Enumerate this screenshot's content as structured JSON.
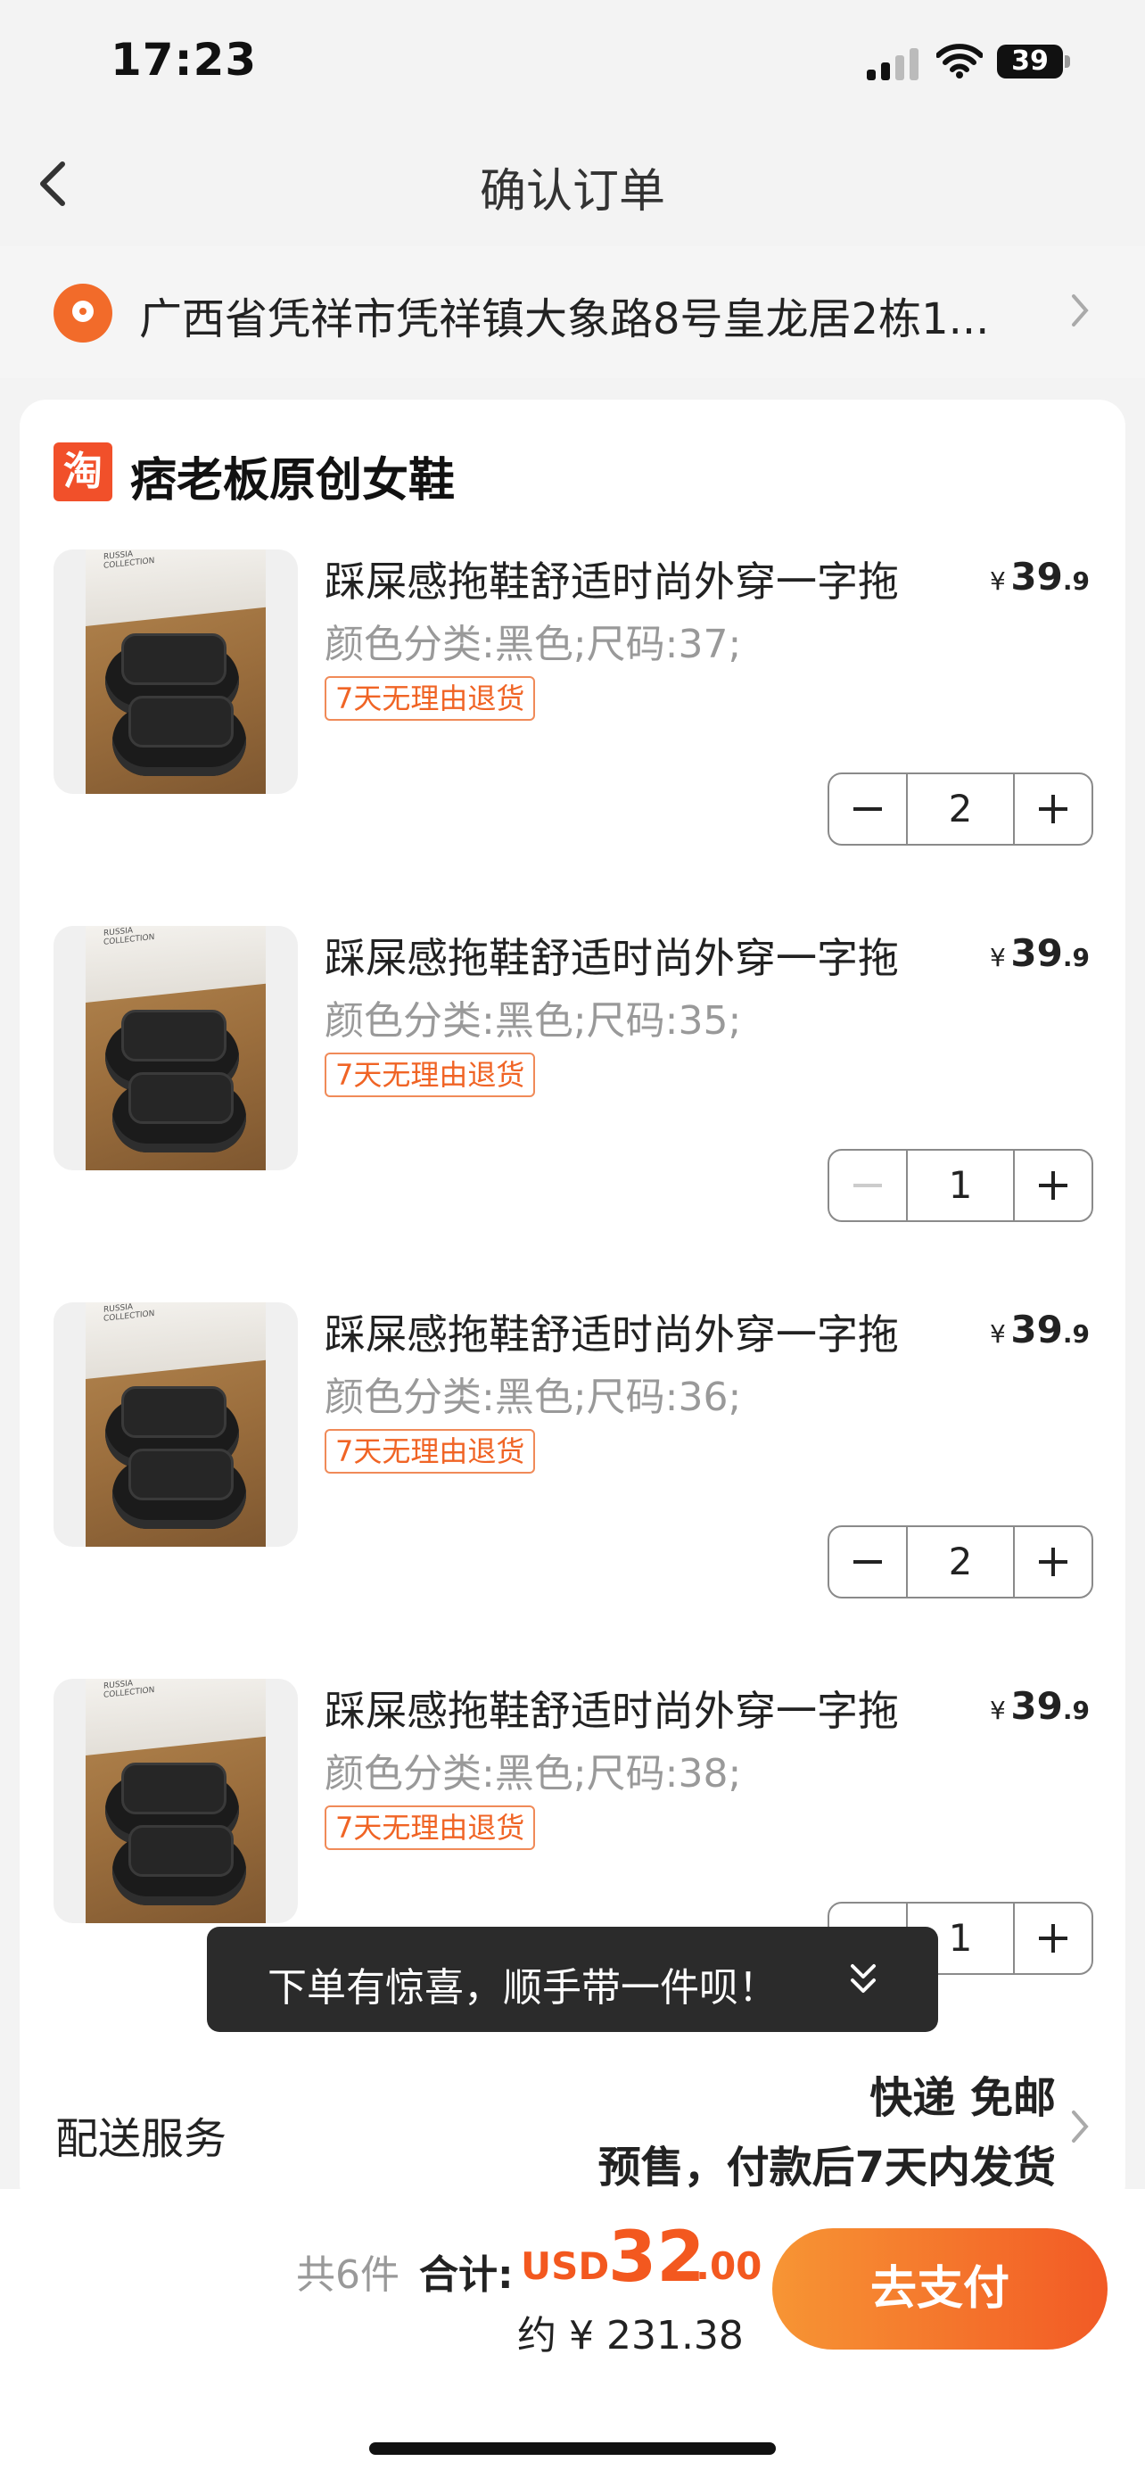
{
  "status_bar": {
    "time": "17:23",
    "battery": "39"
  },
  "nav": {
    "title": "确认订单"
  },
  "address": {
    "text": "广西省凭祥市凭祥镇大象路8号皇龙居2栋1..."
  },
  "store": {
    "logo_char": "淘",
    "name": "痞老板原创女鞋"
  },
  "items": [
    {
      "title": "踩屎感拖鞋舒适时尚外穿一字拖",
      "spec": "颜色分类:黑色;尺码:37;",
      "tag": "7天无理由退货",
      "price_currency": "¥",
      "price_int": "39",
      "price_dec": ".9",
      "quantity": "2"
    },
    {
      "title": "踩屎感拖鞋舒适时尚外穿一字拖",
      "spec": "颜色分类:黑色;尺码:35;",
      "tag": "7天无理由退货",
      "price_currency": "¥",
      "price_int": "39",
      "price_dec": ".9",
      "quantity": "1"
    },
    {
      "title": "踩屎感拖鞋舒适时尚外穿一字拖",
      "spec": "颜色分类:黑色;尺码:36;",
      "tag": "7天无理由退货",
      "price_currency": "¥",
      "price_int": "39",
      "price_dec": ".9",
      "quantity": "2"
    },
    {
      "title": "踩屎感拖鞋舒适时尚外穿一字拖",
      "spec": "颜色分类:黑色;尺码:38;",
      "tag": "7天无理由退货",
      "price_currency": "¥",
      "price_int": "39",
      "price_dec": ".9",
      "quantity": "1"
    }
  ],
  "toast": {
    "text": "下单有惊喜，顺手带一件呗！"
  },
  "delivery": {
    "label": "配送服务",
    "line1": "快递 免邮",
    "line2": "预售，付款后7天内发货"
  },
  "footer": {
    "count": "共6件",
    "total_label": "合计:",
    "currency": "USD",
    "total_int": "32",
    "total_dec": ".00",
    "approx": "约 ¥ 231.38",
    "pay_label": "去支付"
  },
  "colors": {
    "accent": "#f3581f",
    "button_start": "#f79534",
    "button_end": "#f25a25",
    "tag": "#f06425"
  }
}
